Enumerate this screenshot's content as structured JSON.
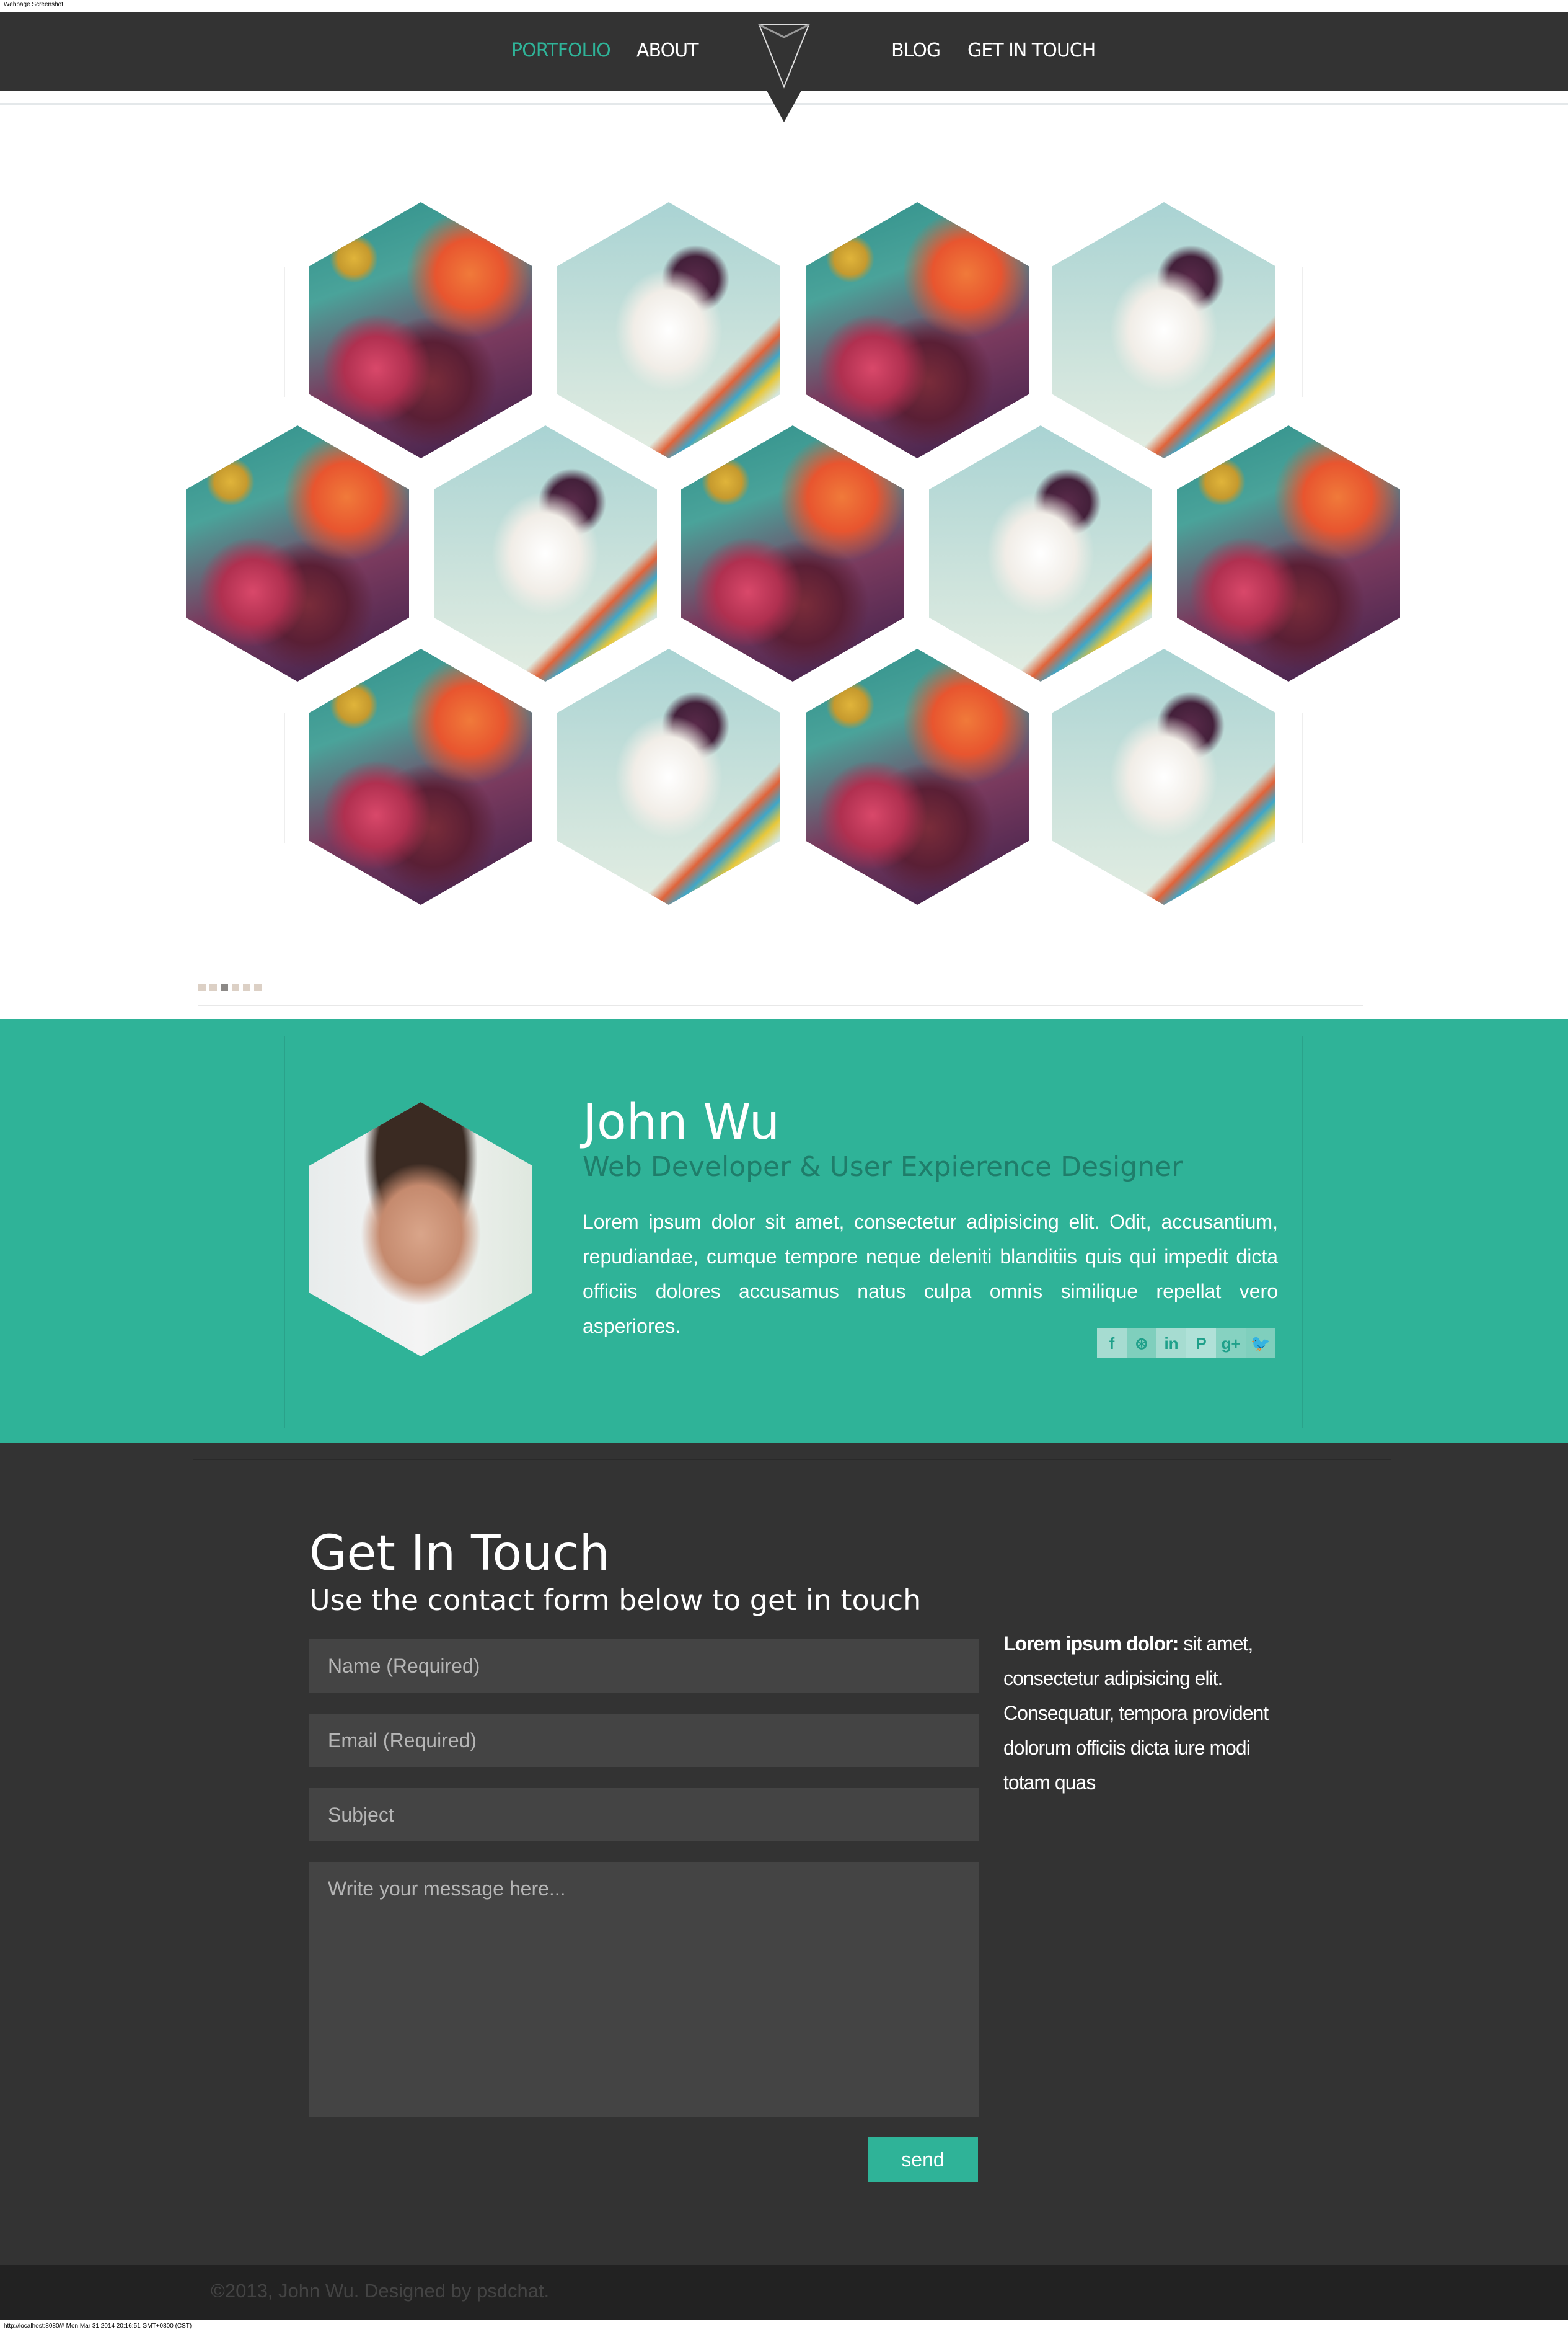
{
  "capture_label": "Webpage Screenshot",
  "nav": {
    "items": [
      {
        "label": "PORTFOLIO"
      },
      {
        "label": "ABOUT"
      },
      {
        "label": "BLOG"
      },
      {
        "label": "GET IN TOUCH"
      }
    ],
    "active": "PORTFOLIO"
  },
  "portfolio": {
    "slider_pages": 6,
    "active_page": 3
  },
  "about": {
    "name": "John Wu",
    "role": "Web Developer & User Expierence Designer",
    "bio": "Lorem ipsum dolor sit amet, consectetur adipisicing elit. Odit, accusantium, repudiandae, cumque tempore neque deleniti blanditiis quis qui impedit dicta officiis dolores accusamus natus culpa omnis similique repellat vero asperiores.",
    "social": [
      {
        "icon": "facebook-icon",
        "glyph": "f"
      },
      {
        "icon": "dribbble-icon",
        "glyph": "⊛"
      },
      {
        "icon": "linkedin-icon",
        "glyph": "in"
      },
      {
        "icon": "pinterest-icon",
        "glyph": "P"
      },
      {
        "icon": "google-plus-icon",
        "glyph": "g+"
      },
      {
        "icon": "twitter-icon",
        "glyph": "🐦"
      }
    ]
  },
  "contact": {
    "title": "Get In Touch",
    "subtitle": "Use the contact form below to get in touch",
    "name_placeholder": "Name (Required)",
    "email_placeholder": "Email (Required)",
    "subject_placeholder": "Subject",
    "message_placeholder": "Write your message here...",
    "send_label": "send",
    "side_bold": "Lorem ipsum dolor:",
    "side_text": " sit amet, consectetur adipisicing elit. Consequatur, tempora provident dolorum officiis dicta iure modi totam quas"
  },
  "footer": {
    "copyright": "©2013, John Wu. Designed by psdchat."
  },
  "status_url": "http://localhost:8080/# Mon Mar 31 2014 20:16:51 GMT+0800 (CST)",
  "colors": {
    "accent": "#2fb398",
    "dark": "#333333",
    "footer": "#222222"
  }
}
